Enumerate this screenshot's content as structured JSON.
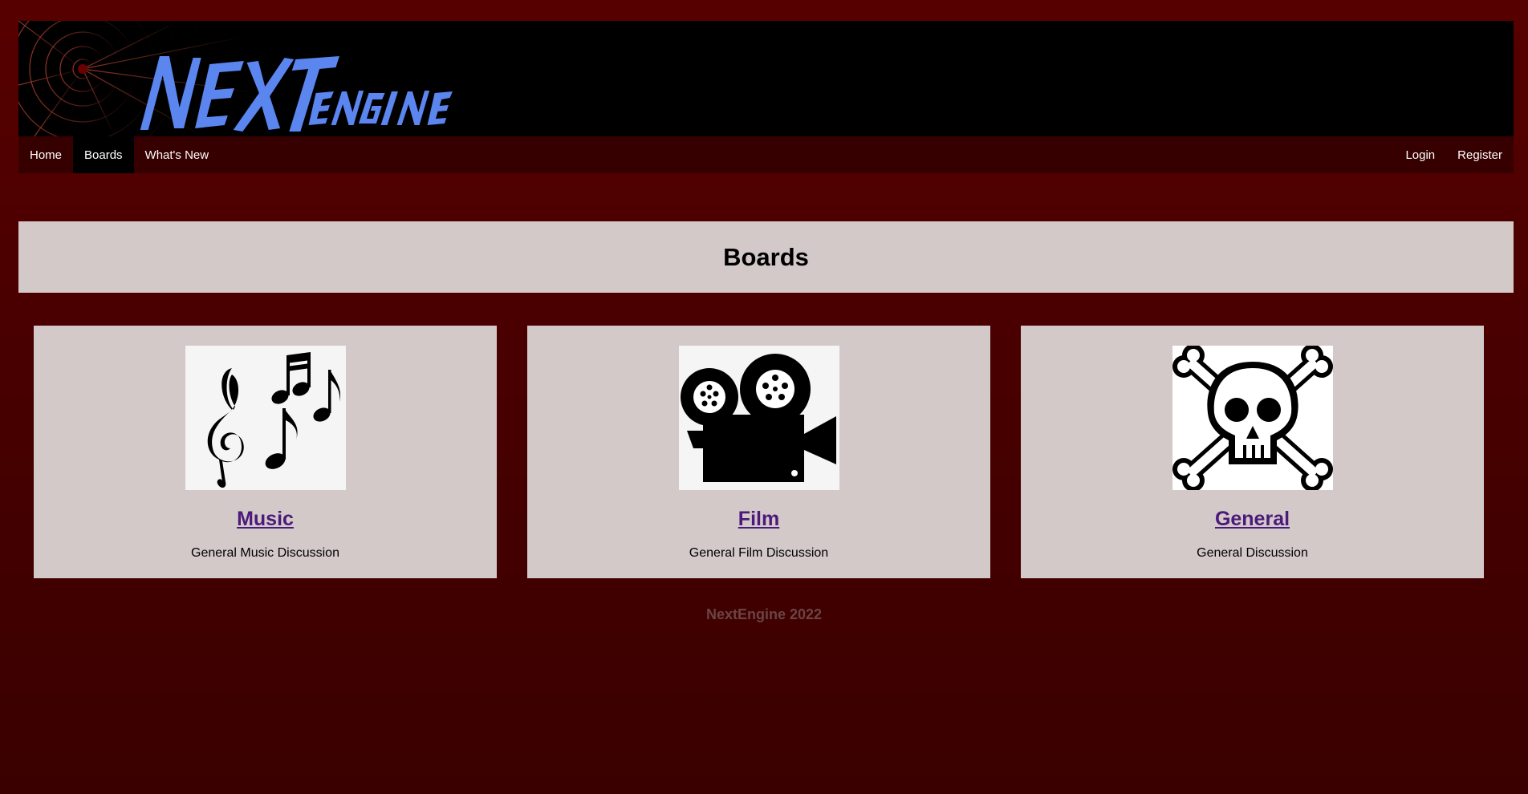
{
  "banner": {
    "logo_text_main": "NEXT",
    "logo_text_secondary": "ENGINE"
  },
  "nav": {
    "left": [
      {
        "label": "Home",
        "active": false
      },
      {
        "label": "Boards",
        "active": true
      },
      {
        "label": "What's New",
        "active": false
      }
    ],
    "right": [
      {
        "label": "Login"
      },
      {
        "label": "Register"
      }
    ]
  },
  "page": {
    "title": "Boards"
  },
  "boards": [
    {
      "title": "Music",
      "description": "General Music Discussion",
      "icon": "music-notes-icon"
    },
    {
      "title": "Film",
      "description": "General Film Discussion",
      "icon": "film-camera-icon"
    },
    {
      "title": "General",
      "description": "General Discussion",
      "icon": "skull-crossbones-icon"
    }
  ],
  "footer": {
    "text": "NextEngine 2022"
  },
  "colors": {
    "background": "#570000",
    "banner": "#000000",
    "navbar": "#360000",
    "panel": "#d4c9c9",
    "link": "#4b1a7a",
    "logo": "#5b86f0",
    "footer_text": "#6a4444"
  }
}
